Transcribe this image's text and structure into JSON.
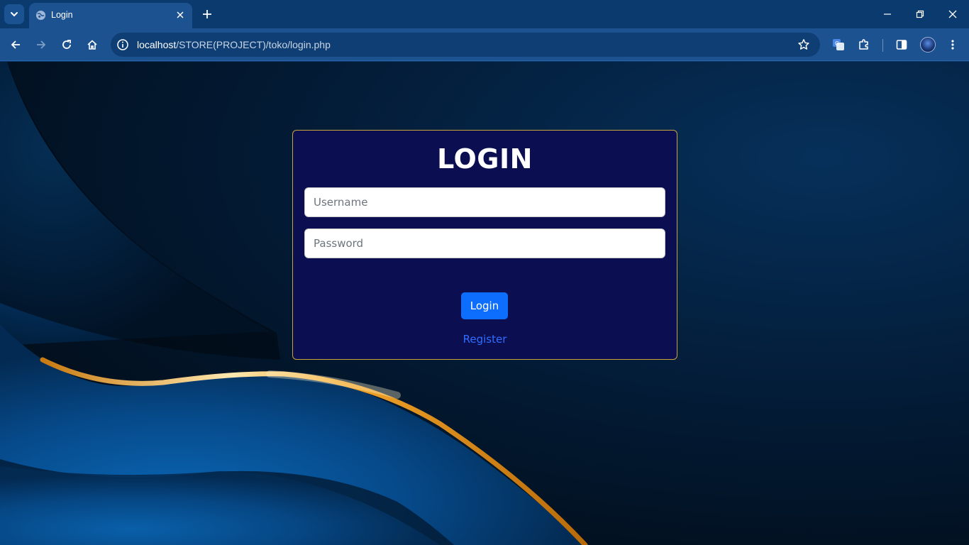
{
  "browser": {
    "tab_title": "Login",
    "url_host": "localhost",
    "url_path": "/STORE(PROJECT)/toko/login.php"
  },
  "icons": {
    "tab_search": "chevron-down-icon",
    "favicon": "globe-icon",
    "tab_close": "close-icon",
    "new_tab": "plus-icon",
    "minimize": "minimize-icon",
    "restore": "restore-icon",
    "close_window": "close-icon",
    "back": "back-arrow-icon",
    "forward": "forward-arrow-icon",
    "reload": "reload-icon",
    "home": "home-icon",
    "site_info": "info-icon",
    "bookmark": "star-icon",
    "translate": "translate-icon",
    "extensions": "puzzle-icon",
    "side_panel": "side-panel-icon",
    "menu": "kebab-menu-icon"
  },
  "login": {
    "title": "LOGIN",
    "username_placeholder": "Username",
    "password_placeholder": "Password",
    "submit_label": "Login",
    "register_label": "Register"
  },
  "colors": {
    "card_bg": "#0b0f52",
    "card_border": "#c9a43a",
    "primary_button": "#0d6efd",
    "link": "#2f6dff",
    "chrome": "#1d5290"
  }
}
